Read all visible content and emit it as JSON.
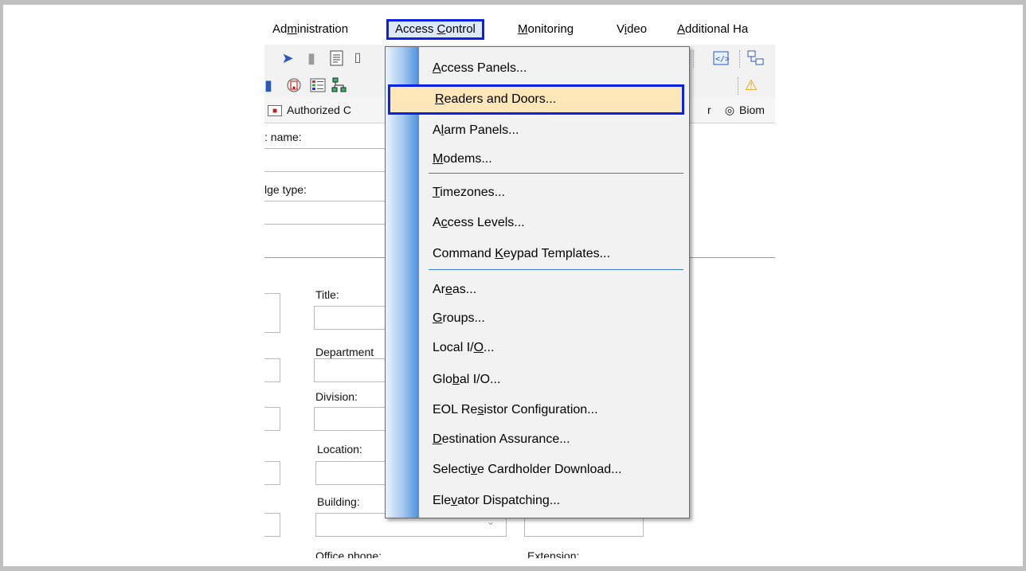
{
  "menubar": {
    "items": [
      {
        "pre": "Ad",
        "key": "m",
        "post": "inistration"
      },
      {
        "pre": "Access ",
        "key": "C",
        "post": "ontrol"
      },
      {
        "pre": "",
        "key": "M",
        "post": "onitoring"
      },
      {
        "pre": "V",
        "key": "i",
        "post": "deo"
      },
      {
        "pre": "",
        "key": "A",
        "post": "dditional Ha"
      }
    ]
  },
  "tabs": {
    "authorized": "Authorized C",
    "r_fragment": "r",
    "biometric": "Biom"
  },
  "form": {
    "name_label": ": name:",
    "badge_label": "lge type:",
    "title_label": "Title:",
    "department_label": "Department",
    "division_label": "Division:",
    "location_label": "Location:",
    "building_label": "Building:",
    "office_phone_label": "Office phone:",
    "extension_label": "Extension:"
  },
  "menu": {
    "items": [
      {
        "pre": "",
        "key": "A",
        "post": "ccess Panels..."
      },
      {
        "pre": "",
        "key": "R",
        "post": "eaders and Doors..."
      },
      {
        "pre": "A",
        "key": "l",
        "post": "arm Panels..."
      },
      {
        "pre": "",
        "key": "M",
        "post": "odems..."
      },
      {
        "pre": "",
        "key": "T",
        "post": "imezones..."
      },
      {
        "pre": "A",
        "key": "c",
        "post": "cess Levels..."
      },
      {
        "pre": "Command ",
        "key": "K",
        "post": "eypad Templates..."
      },
      {
        "pre": "Ar",
        "key": "e",
        "post": "as..."
      },
      {
        "pre": "",
        "key": "G",
        "post": "roups..."
      },
      {
        "pre": "Local I/",
        "key": "O",
        "post": "..."
      },
      {
        "pre": "Glo",
        "key": "b",
        "post": "al I/O..."
      },
      {
        "pre": "EOL Re",
        "key": "s",
        "post": "istor Configuration..."
      },
      {
        "pre": "",
        "key": "D",
        "post": "estination Assurance..."
      },
      {
        "pre": "Selecti",
        "key": "v",
        "post": "e Cardholder Download..."
      },
      {
        "pre": "Ele",
        "key": "v",
        "post": "ator Dispatching..."
      }
    ],
    "highlighted_index": 1,
    "highlight_color": "#fde7b8",
    "focus_border_color": "#0b22e6"
  }
}
